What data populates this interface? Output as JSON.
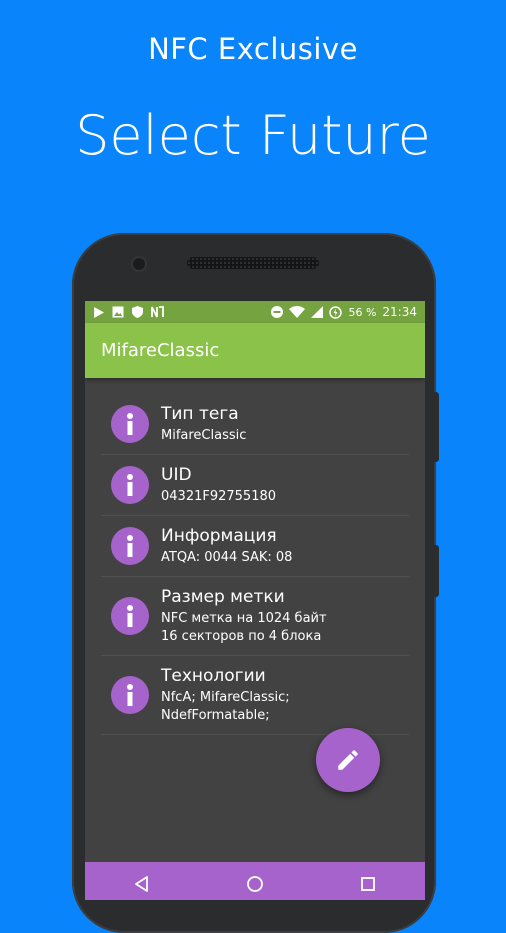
{
  "promo": {
    "subtitle": "NFC Exclusive",
    "title": "Select Future"
  },
  "status_bar": {
    "left_icons": [
      "play-icon",
      "image-icon",
      "shield-icon",
      "nfc-icon"
    ],
    "right_icons": [
      "dnd-icon",
      "wifi-icon",
      "signal-icon",
      "battery-icon"
    ],
    "battery": "56 %",
    "time": "21:34"
  },
  "app_bar": {
    "title": "MifareClassic"
  },
  "tag_info": [
    {
      "title": "Тип тега",
      "lines": [
        "MifareClassic"
      ]
    },
    {
      "title": "UID",
      "lines": [
        "04321F92755180"
      ]
    },
    {
      "title": "Информация",
      "lines": [
        "ATQA: 0044 SAK: 08"
      ]
    },
    {
      "title": "Размер метки",
      "lines": [
        "NFC метка на 1024 байт",
        "16 секторов по 4 блока"
      ]
    },
    {
      "title": "Технологии",
      "lines": [
        "NfcA; MifareClassic;",
        "NdefFormatable;"
      ]
    }
  ],
  "fab": {
    "icon": "pencil-icon"
  },
  "nav_bar": {
    "icons": [
      "back-icon",
      "home-icon",
      "recents-icon"
    ]
  },
  "colors": {
    "background": "#0a84fb",
    "app_bar": "#8bc34a",
    "status_bar": "#75a340",
    "accent": "#a663cc",
    "screen": "#424242"
  }
}
